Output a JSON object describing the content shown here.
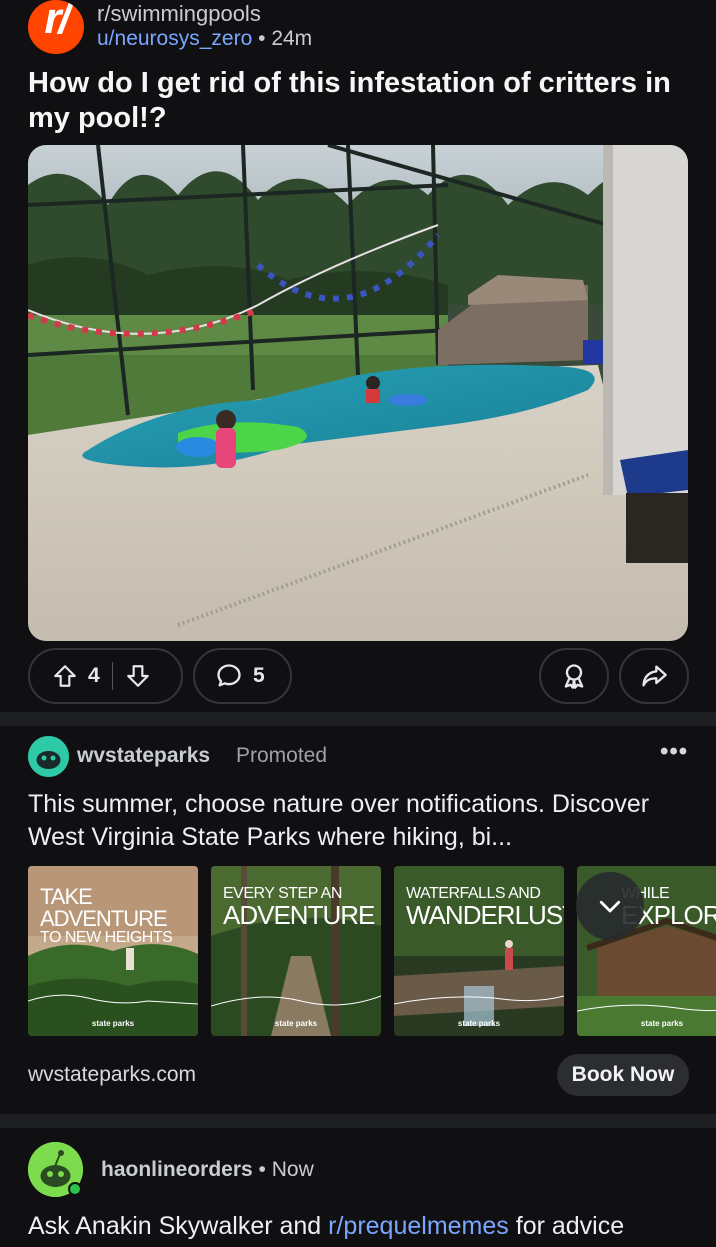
{
  "post": {
    "subreddit": "r/swimmingpools",
    "author": "u/neurosys_zero",
    "separator": "•",
    "time": "24m",
    "title": "How do I get rid of this infestation of critters in my pool!?",
    "upvotes": "4",
    "comments": "5",
    "icon_letter": "r/"
  },
  "ad": {
    "advertiser": "wvstateparks",
    "promoted_label": "Promoted",
    "more": "•••",
    "body": "This summer, choose nature over notifications. Discover West Virginia State Parks where hiking, bi...",
    "cards": [
      {
        "line1": "TAKE ADVENTURE",
        "line2": "TO NEW HEIGHTS",
        "brand": "state parks"
      },
      {
        "line1": "EVERY STEP AN",
        "line2": "ADVENTURE",
        "brand": "state parks"
      },
      {
        "line1": "WATERFALLS AND",
        "line2": "WANDERLUST",
        "brand": "state parks"
      },
      {
        "line1": "WHILE",
        "line2": "EXPLORE",
        "brand": "state parks"
      }
    ],
    "domain": "wvstateparks.com",
    "cta": "Book Now"
  },
  "post2": {
    "author": "haonlineorders",
    "separator": "•",
    "time": "Now",
    "title_prefix": "Ask Anakin Skywalker and ",
    "title_link": "r/prequelmemes",
    "title_suffix": " for advice"
  },
  "colors": {
    "brand_orange": "#ff4500",
    "link_blue": "#7aa6ff",
    "background": "#101012"
  }
}
